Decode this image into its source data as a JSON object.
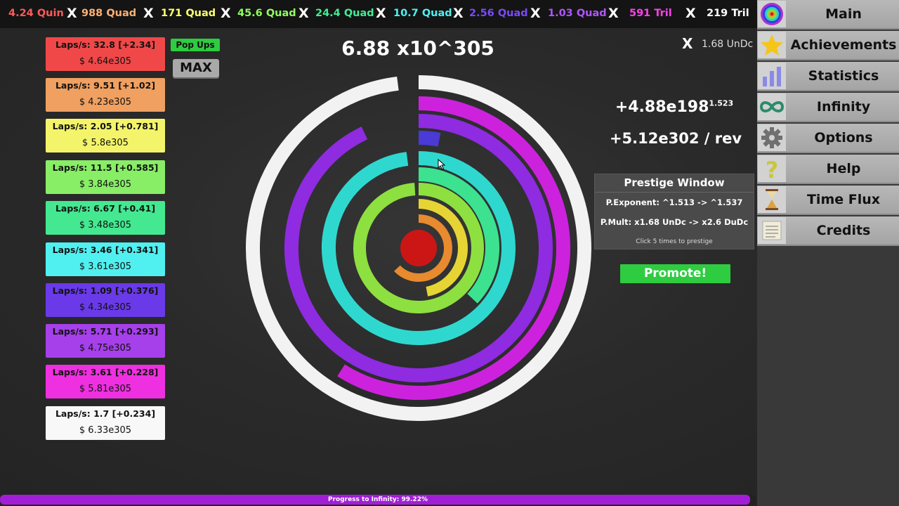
{
  "top_multipliers": [
    {
      "text": "4.24 Quin",
      "color": "#ff5a5a"
    },
    {
      "text": "988 Quad",
      "color": "#ffb070"
    },
    {
      "text": "171 Quad",
      "color": "#ffff70"
    },
    {
      "text": "45.6 Quad",
      "color": "#90ff60"
    },
    {
      "text": "24.4 Quad",
      "color": "#40ee90"
    },
    {
      "text": "10.7 Quad",
      "color": "#50f0f0"
    },
    {
      "text": "2.56 Quad",
      "color": "#7a4aff"
    },
    {
      "text": "1.03 Quad",
      "color": "#b055ff"
    },
    {
      "text": "591 Tril",
      "color": "#ff40f0"
    },
    {
      "text": "219 Tril",
      "color": "#ffffff"
    }
  ],
  "top_separator": "X",
  "menu": [
    {
      "label": "Main",
      "icon": "target-icon"
    },
    {
      "label": "Achievements",
      "icon": "star-icon"
    },
    {
      "label": "Statistics",
      "icon": "bar-chart-icon"
    },
    {
      "label": "Infinity",
      "icon": "infinity-icon"
    },
    {
      "label": "Options",
      "icon": "gear-icon"
    },
    {
      "label": "Help",
      "icon": "question-icon"
    },
    {
      "label": "Time Flux",
      "icon": "hourglass-icon"
    },
    {
      "label": "Credits",
      "icon": "document-icon"
    }
  ],
  "laps": [
    {
      "laps": "Laps/s: 32.8 [+2.34]",
      "cost": "$ 4.64e305",
      "color": "#f04848"
    },
    {
      "laps": "Laps/s: 9.51 [+1.02]",
      "cost": "$ 4.23e305",
      "color": "#f0a060"
    },
    {
      "laps": "Laps/s: 2.05 [+0.781]",
      "cost": "$ 5.8e305",
      "color": "#f4f46a"
    },
    {
      "laps": "Laps/s: 11.5 [+0.585]",
      "cost": "$ 3.84e305",
      "color": "#88ee66"
    },
    {
      "laps": "Laps/s: 6.67 [+0.41]",
      "cost": "$ 3.48e305",
      "color": "#44e890"
    },
    {
      "laps": "Laps/s: 3.46 [+0.341]",
      "cost": "$ 3.61e305",
      "color": "#50f0f0"
    },
    {
      "laps": "Laps/s: 1.09 [+0.376]",
      "cost": "$ 4.34e305",
      "color": "#6a3ae8"
    },
    {
      "laps": "Laps/s: 5.71 [+0.293]",
      "cost": "$ 4.75e305",
      "color": "#a640ea"
    },
    {
      "laps": "Laps/s: 3.61 [+0.228]",
      "cost": "$ 5.81e305",
      "color": "#ee30e0"
    },
    {
      "laps": "Laps/s: 1.7 [+0.234]",
      "cost": "$ 6.33e305",
      "color": "#f8f8f8"
    }
  ],
  "popups_label": "Pop Ups",
  "max_label": "MAX",
  "money": "6.88 x10^305",
  "close_x": "X",
  "undc": "1.68 UnDc",
  "gain_base": "+4.88e198",
  "gain_exp": "1.523",
  "per_rev": "+5.12e302 / rev",
  "prestige": {
    "title": "Prestige Window",
    "exponent": "P.Exponent: ^1.513 -> ^1.537",
    "mult": "P.Mult: x1.68 UnDc -> x2.6 DuDc",
    "click": "Click 5 times to prestige"
  },
  "promote_label": "Promote!",
  "progress": {
    "text": "Progress to Infinity: 99.22%",
    "percent": 99.22
  },
  "rings": [
    {
      "color": "#f2f2f2",
      "fill": 0.98
    },
    {
      "color": "#cc22dd",
      "fill": 0.59
    },
    {
      "color": "#8f2be0",
      "fill": 0.93
    },
    {
      "color": "#4a3ad6",
      "fill": 0.03
    },
    {
      "color": "#2fd8cf",
      "fill": 0.98
    },
    {
      "color": "#3ce290",
      "fill": 0.37
    },
    {
      "color": "#8ee040",
      "fill": 0.99
    },
    {
      "color": "#e6d435",
      "fill": 0.47
    },
    {
      "color": "#e88a2e",
      "fill": 0.63
    },
    {
      "color": "#cc1616",
      "fill": 1.0
    }
  ]
}
